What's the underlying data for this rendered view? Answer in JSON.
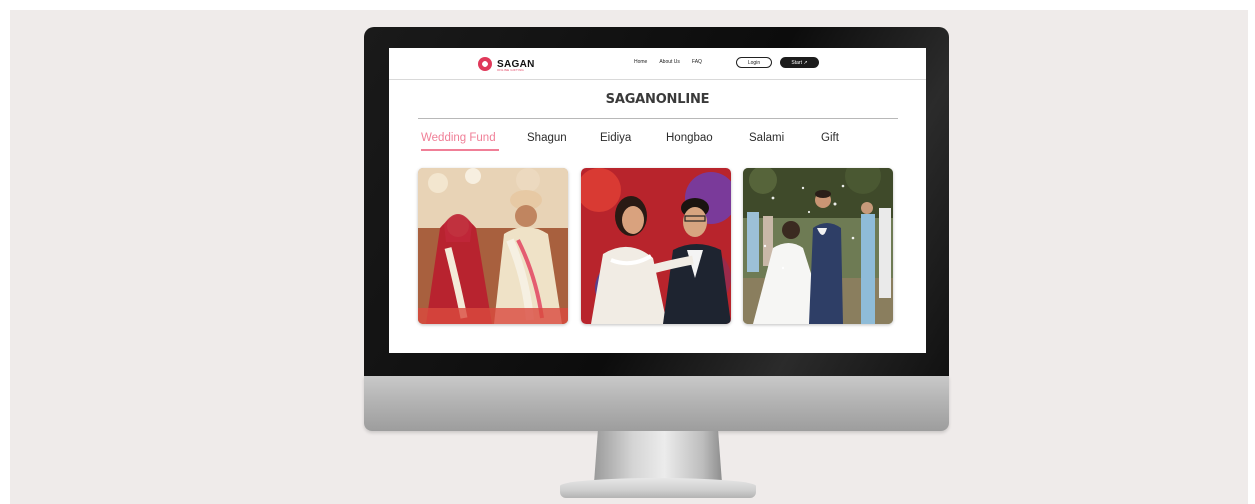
{
  "brand": {
    "name": "SAGAN",
    "tagline": "ONLINE GIFTING",
    "accent": "#f07f97",
    "logo_color": "#e0395a"
  },
  "nav": {
    "links": [
      "Home",
      "About Us",
      "FAQ"
    ],
    "login_label": "Login",
    "start_label": "Start ↗"
  },
  "page_title": "SAGANONLINE",
  "tabs": [
    {
      "label": "Wedding Fund",
      "active": true
    },
    {
      "label": "Shagun",
      "active": false
    },
    {
      "label": "Eidiya",
      "active": false
    },
    {
      "label": "Hongbao",
      "active": false
    },
    {
      "label": "Salami",
      "active": false
    },
    {
      "label": "Gift",
      "active": false
    }
  ],
  "cards": [
    {
      "subject": "indian-wedding-couple-photo"
    },
    {
      "subject": "asian-wedding-couple-photo"
    },
    {
      "subject": "outdoor-wedding-couple-photo"
    }
  ]
}
